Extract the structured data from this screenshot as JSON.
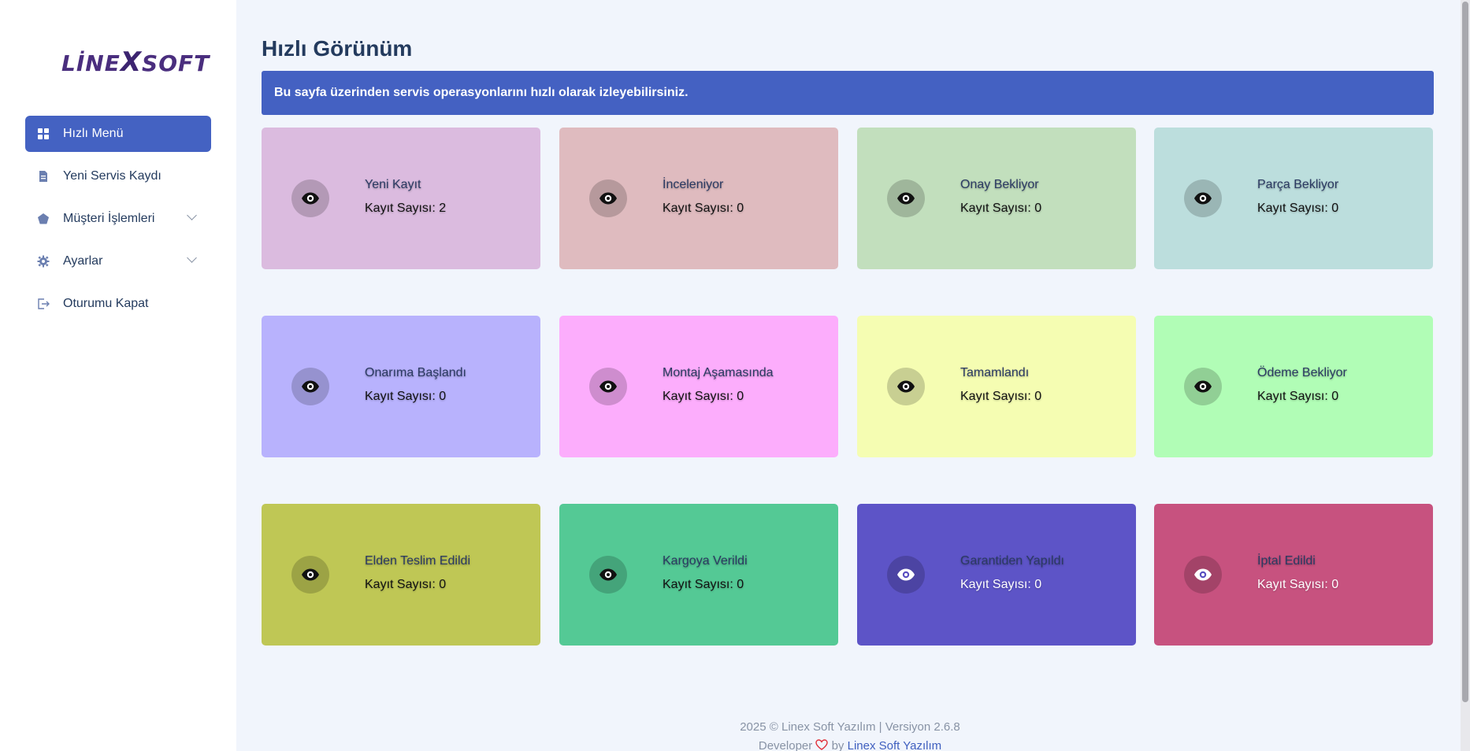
{
  "sidebar": {
    "logo": {
      "pre": "LİNE",
      "x": "X",
      "post": "SOFT"
    },
    "items": [
      {
        "label": "Hızlı Menü",
        "icon": "grid-icon",
        "active": true
      },
      {
        "label": "Yeni Servis Kaydı",
        "icon": "document-icon"
      },
      {
        "label": "Müşteri İşlemleri",
        "icon": "pentagon-icon",
        "expandable": true
      },
      {
        "label": "Ayarlar",
        "icon": "gear-icon",
        "expandable": true
      },
      {
        "label": "Oturumu Kapat",
        "icon": "logout-icon"
      }
    ]
  },
  "main": {
    "title": "Hızlı Görünüm",
    "info": "Bu sayfa üzerinden servis operasyonlarını hızlı olarak izleyebilirsiniz.",
    "count_prefix": "Kayıt Sayısı:",
    "cards": [
      {
        "title": "Yeni Kayıt",
        "count": "Kayıt Sayısı: 2",
        "color": "#dbbbdf"
      },
      {
        "title": "İnceleniyor",
        "count": "Kayıt Sayısı: 0",
        "color": "#dfbbbf"
      },
      {
        "title": "Onay Bekliyor",
        "count": "Kayıt Sayısı: 0",
        "color": "#c2dfbd"
      },
      {
        "title": "Parça Bekliyor",
        "count": "Kayıt Sayısı: 0",
        "color": "#bcdedd"
      },
      {
        "title": "Onarıma Başlandı",
        "count": "Kayıt Sayısı: 0",
        "color": "#b8b2fd"
      },
      {
        "title": "Montaj Aşamasında",
        "count": "Kayıt Sayısı: 0",
        "color": "#fcadfc"
      },
      {
        "title": "Tamamlandı",
        "count": "Kayıt Sayısı: 0",
        "color": "#f5fdb2"
      },
      {
        "title": "Ödeme Bekliyor",
        "count": "Kayıt Sayısı: 0",
        "color": "#b1fdb6"
      },
      {
        "title": "Elden Teslim Edildi",
        "count": "Kayıt Sayısı: 0",
        "color": "#bfc755"
      },
      {
        "title": "Kargoya Verildi",
        "count": "Kayıt Sayısı: 0",
        "color": "#54c995"
      },
      {
        "title": "Garantiden Yapıldı",
        "count": "Kayıt Sayısı: 0",
        "color": "#5d54c7"
      },
      {
        "title": "İptal Edildi",
        "count": "Kayıt Sayısı: 0",
        "color": "#c7527f"
      }
    ]
  },
  "footer": {
    "line1": "2025 © Linex Soft Yazılım | Versiyon 2.6.8",
    "developer": "Developer",
    "by": "by",
    "link": "Linex Soft Yazılım"
  }
}
